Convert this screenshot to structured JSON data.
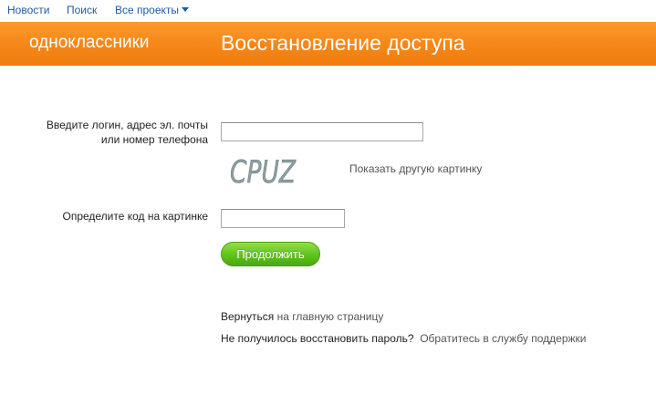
{
  "topnav": {
    "news": "Новости",
    "search": "Поиск",
    "all_projects": "Все проекты"
  },
  "header": {
    "logo": "одноклассники",
    "title": "Восстановление доступа"
  },
  "form": {
    "login_label_line1": "Введите логин, адрес эл. почты",
    "login_label_line2": "или номер телефона",
    "login_value": "",
    "captcha_text": "CPUZ",
    "show_other_picture": "Показать другую картинку",
    "code_label": "Определите код на картинке",
    "code_value": "",
    "continue_button": "Продолжить"
  },
  "footer_links": {
    "return_prefix": "Вернуться",
    "return_link": "на главную страницу",
    "failed_prefix": "Не получилось восстановить пароль?",
    "support_link": "Обратитесь в службу поддержки"
  },
  "colors": {
    "header_orange": "#f6891a",
    "link_blue": "#1f59a8",
    "button_green": "#5fc21d"
  }
}
